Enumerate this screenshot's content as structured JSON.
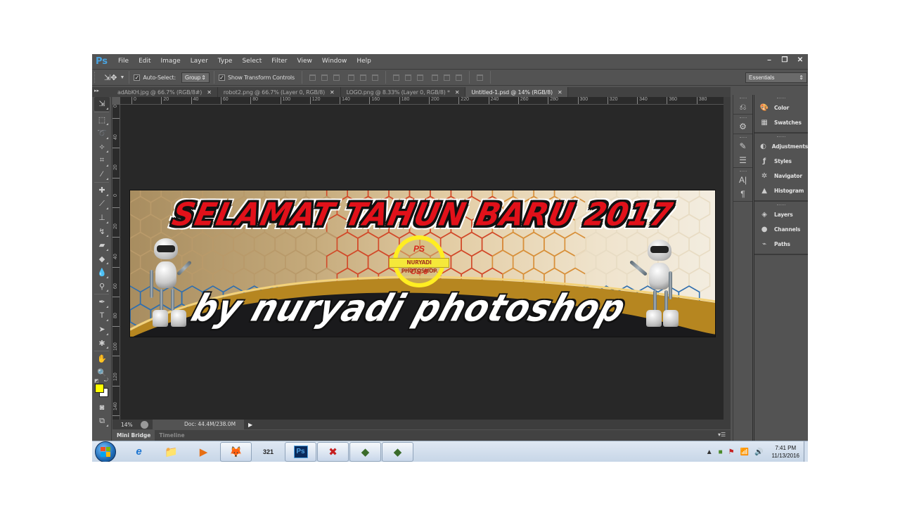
{
  "app": {
    "logo": "Ps",
    "menus": [
      "File",
      "Edit",
      "Image",
      "Layer",
      "Type",
      "Select",
      "Filter",
      "View",
      "Window",
      "Help"
    ]
  },
  "window_controls": {
    "minimize": "–",
    "restore": "❐",
    "close": "✕"
  },
  "options": {
    "tool_icon": "move-tool",
    "auto_select_label": "Auto-Select:",
    "auto_select_checked": true,
    "auto_select_mode": "Group",
    "show_transform_label": "Show Transform Controls",
    "show_transform_checked": true,
    "workspace": "Essentials"
  },
  "tabs": [
    {
      "label": "adAbKH.jpg @ 66.7% (RGB/8#)",
      "active": false
    },
    {
      "label": "robot2.png @ 66.7% (Layer 0, RGB/8)",
      "active": false
    },
    {
      "label": "LOGO.png @ 8.33% (Layer 0, RGB/8) *",
      "active": false
    },
    {
      "label": "Untitled-1.psd @ 14% (RGB/8)",
      "active": true
    }
  ],
  "hruler_labels": [
    "0",
    "20",
    "40",
    "60",
    "80",
    "100",
    "120",
    "140",
    "160",
    "180",
    "200",
    "220",
    "240",
    "260",
    "280",
    "300",
    "320",
    "340",
    "360",
    "380",
    "40"
  ],
  "vruler_labels": [
    "0",
    "40",
    "20",
    "0",
    "20",
    "40",
    "60",
    "80",
    "100",
    "120",
    "140"
  ],
  "banner": {
    "headline": "SELAMAT TAHUN BARU 2017",
    "byline": "by nuryadi photoshop",
    "logo_top": "PS",
    "logo_band": "NURYADI PHOTOSHOP",
    "logo_bottom": "CS 6"
  },
  "status": {
    "zoom": "14%",
    "doc": "Doc: 44.4M/238.0M"
  },
  "bottom_tabs": [
    {
      "label": "Mini Bridge",
      "active": true
    },
    {
      "label": "Timeline",
      "active": false
    }
  ],
  "right_panels": [
    {
      "group": 1,
      "items": [
        {
          "icon": "color-icon",
          "glyph": "🎨",
          "label": "Color"
        },
        {
          "icon": "swatches-icon",
          "glyph": "▦",
          "label": "Swatches"
        }
      ]
    },
    {
      "group": 2,
      "items": [
        {
          "icon": "adjustments-icon",
          "glyph": "◐",
          "label": "Adjustments"
        },
        {
          "icon": "styles-icon",
          "glyph": "ƒ",
          "label": "Styles"
        },
        {
          "icon": "navigator-icon",
          "glyph": "✲",
          "label": "Navigator"
        },
        {
          "icon": "histogram-icon",
          "glyph": "▲",
          "label": "Histogram"
        }
      ]
    },
    {
      "group": 3,
      "items": [
        {
          "icon": "layers-icon",
          "glyph": "◈",
          "label": "Layers"
        },
        {
          "icon": "channels-icon",
          "glyph": "●",
          "label": "Channels"
        },
        {
          "icon": "paths-icon",
          "glyph": "⌁",
          "label": "Paths"
        }
      ]
    }
  ],
  "colors": {
    "foreground": "#ffff00",
    "background": "#ffffff"
  },
  "taskbar": {
    "apps": [
      "internet-explorer",
      "windows-explorer",
      "media-player",
      "firefox",
      "media-player-classic",
      "photoshop",
      "pdf-tool",
      "terminal-app-1",
      "terminal-app-2"
    ],
    "time": "7:41 PM",
    "date": "11/13/2016"
  }
}
